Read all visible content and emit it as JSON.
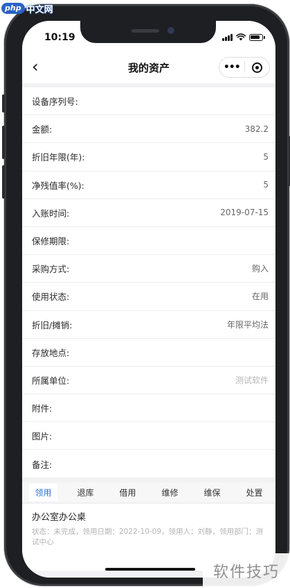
{
  "site_logo": {
    "php": "php",
    "cn": "中文网"
  },
  "status_bar": {
    "time": "10:19"
  },
  "navbar": {
    "back_icon": "‹",
    "title": "我的资产",
    "more": "•••"
  },
  "fields": [
    {
      "label": "设备序列号:",
      "value": ""
    },
    {
      "label": "金额:",
      "value": "382.2"
    },
    {
      "label": "折旧年限(年):",
      "value": "5"
    },
    {
      "label": "净残值率(%):",
      "value": "5"
    },
    {
      "label": "入账时间:",
      "value": "2019-07-15"
    },
    {
      "label": "保修期限:",
      "value": ""
    },
    {
      "label": "采购方式:",
      "value": "购入"
    },
    {
      "label": "使用状态:",
      "value": "在用"
    },
    {
      "label": "折旧/摊销:",
      "value": "年限平均法"
    },
    {
      "label": "存放地点:",
      "value": ""
    },
    {
      "label": "所属单位:",
      "value": "测试软件"
    },
    {
      "label": "附件:",
      "value": ""
    },
    {
      "label": "图片:",
      "value": ""
    },
    {
      "label": "备注:",
      "value": ""
    }
  ],
  "tabs": [
    {
      "label": "领用",
      "active": true
    },
    {
      "label": "退库"
    },
    {
      "label": "借用"
    },
    {
      "label": "维修"
    },
    {
      "label": "维保"
    },
    {
      "label": "处置"
    }
  ],
  "record_card": {
    "name": "办公室办公桌",
    "info": "状态：未完成，领用日期：2022-10-09，领用人：刘静，领用部门：测试中心"
  },
  "watermark": {
    "text": "软件技巧"
  },
  "colors": {
    "accent": "#2f6fd0",
    "phone_frame": "#1e1f22",
    "screen_bg": "#f2f2f4"
  }
}
